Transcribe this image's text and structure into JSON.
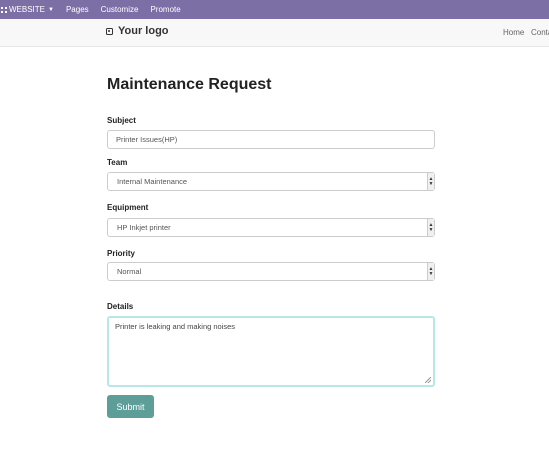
{
  "admin_bar": {
    "website_label": "WEBSITE",
    "pages_label": "Pages",
    "customize_label": "Customize",
    "promote_label": "Promote"
  },
  "header": {
    "logo_text": "Your logo",
    "nav": {
      "home": "Home",
      "contact": "Conta"
    }
  },
  "form": {
    "title": "Maintenance Request",
    "subject": {
      "label": "Subject",
      "value": "Printer Issues(HP)"
    },
    "team": {
      "label": "Team",
      "value": "Internal Maintenance"
    },
    "equipment": {
      "label": "Equipment",
      "value": "HP Inkjet printer"
    },
    "priority": {
      "label": "Priority",
      "value": "Normal"
    },
    "details": {
      "label": "Details",
      "value": "Printer is leaking and making noises"
    },
    "submit_label": "Submit"
  },
  "colors": {
    "admin_bar_bg": "#7b6fa6",
    "submit_bg": "#5e9e99",
    "focus_border": "#b9e6e6"
  }
}
